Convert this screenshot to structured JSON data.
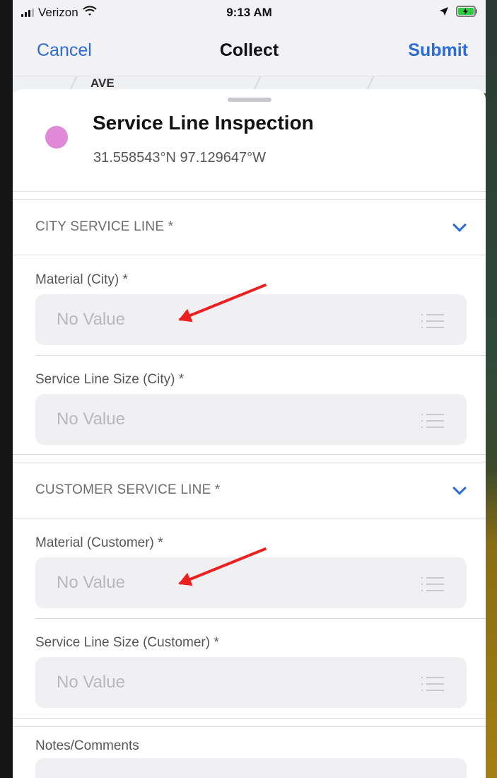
{
  "status_bar": {
    "carrier": "Verizon",
    "time": "9:13 AM"
  },
  "nav": {
    "cancel": "Cancel",
    "title": "Collect",
    "submit": "Submit"
  },
  "map": {
    "road_label": "AVE"
  },
  "form": {
    "title": "Service Line Inspection",
    "coordinates": "31.558543°N  97.129647°W",
    "sections": [
      {
        "header": "CITY SERVICE LINE *",
        "fields": [
          {
            "label": "Material (City) *",
            "placeholder": "No Value"
          },
          {
            "label": "Service Line Size (City) *",
            "placeholder": "No Value"
          }
        ]
      },
      {
        "header": "CUSTOMER SERVICE LINE *",
        "fields": [
          {
            "label": "Material (Customer) *",
            "placeholder": "No Value"
          },
          {
            "label": "Service Line Size (Customer) *",
            "placeholder": "No Value"
          }
        ]
      }
    ],
    "notes_label": "Notes/Comments"
  },
  "colors": {
    "accent": "#2e6bd4",
    "pin": "#e08ad7",
    "annotation_arrow": "#ee1f1f"
  }
}
